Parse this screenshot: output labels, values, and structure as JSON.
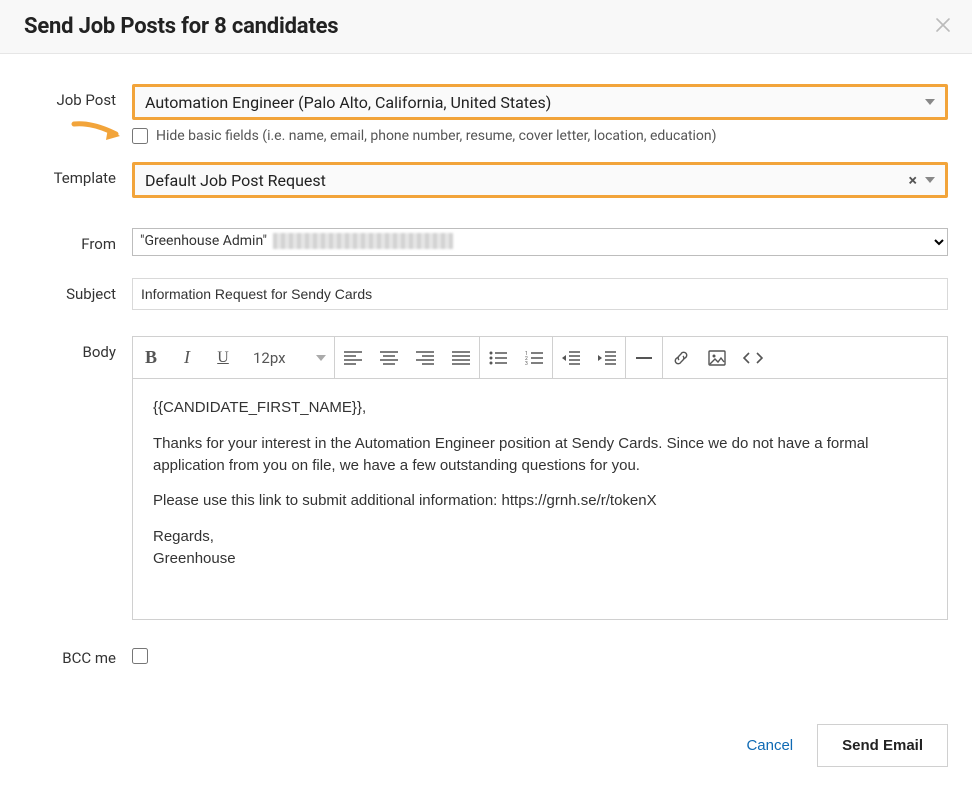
{
  "header": {
    "title": "Send Job Posts for 8 candidates"
  },
  "labels": {
    "job_post": "Job Post",
    "template": "Template",
    "from": "From",
    "subject": "Subject",
    "body": "Body",
    "bcc": "BCC me"
  },
  "job_post": {
    "selected": "Automation Engineer (Palo Alto, California, United States)",
    "hide_fields_label": "Hide basic fields (i.e. name, email, phone number, resume, cover letter, location, education)",
    "hide_fields_checked": false
  },
  "template": {
    "selected": "Default Job Post Request"
  },
  "from": {
    "display_name": "\"Greenhouse Admin\""
  },
  "subject": {
    "value": "Information Request for Sendy Cards"
  },
  "editor": {
    "font_size": "12px",
    "buttons": {
      "bold": "B",
      "italic": "I",
      "underline": "U"
    },
    "body_lines": {
      "greeting": "{{CANDIDATE_FIRST_NAME}},",
      "p1": "Thanks for your interest in the Automation Engineer position at Sendy Cards. Since we do not have a formal application from you on file, we have a few outstanding questions for you.",
      "p2": "Please use this link to submit additional information: https://grnh.se/r/tokenX",
      "signoff1": "Regards,",
      "signoff2": "Greenhouse"
    }
  },
  "bcc_checked": false,
  "footer": {
    "cancel": "Cancel",
    "send": "Send Email"
  },
  "colors": {
    "highlight": "#f2a43a"
  }
}
